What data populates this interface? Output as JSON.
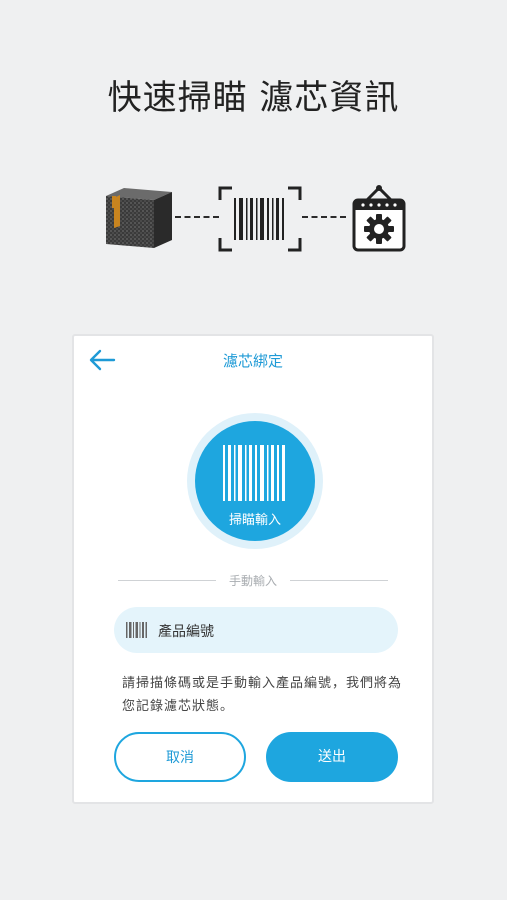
{
  "headline": "快速掃瞄 濾芯資訊",
  "flow": {
    "icons": [
      "package-box-icon",
      "barcode-scan-icon",
      "device-gear-icon"
    ]
  },
  "card": {
    "title": "濾芯綁定",
    "scan_label": "掃瞄輸入",
    "divider_label": "手動輸入",
    "input": {
      "value": "產品編號",
      "icon": "barcode-icon"
    },
    "hint": "請掃描條碼或是手動輸入產品編號，我們將為您記錄濾芯狀態。",
    "cancel_label": "取消",
    "submit_label": "送出"
  },
  "colors": {
    "accent": "#1ea6df",
    "background": "#eff0f1",
    "input_bg": "#e4f4fb"
  }
}
